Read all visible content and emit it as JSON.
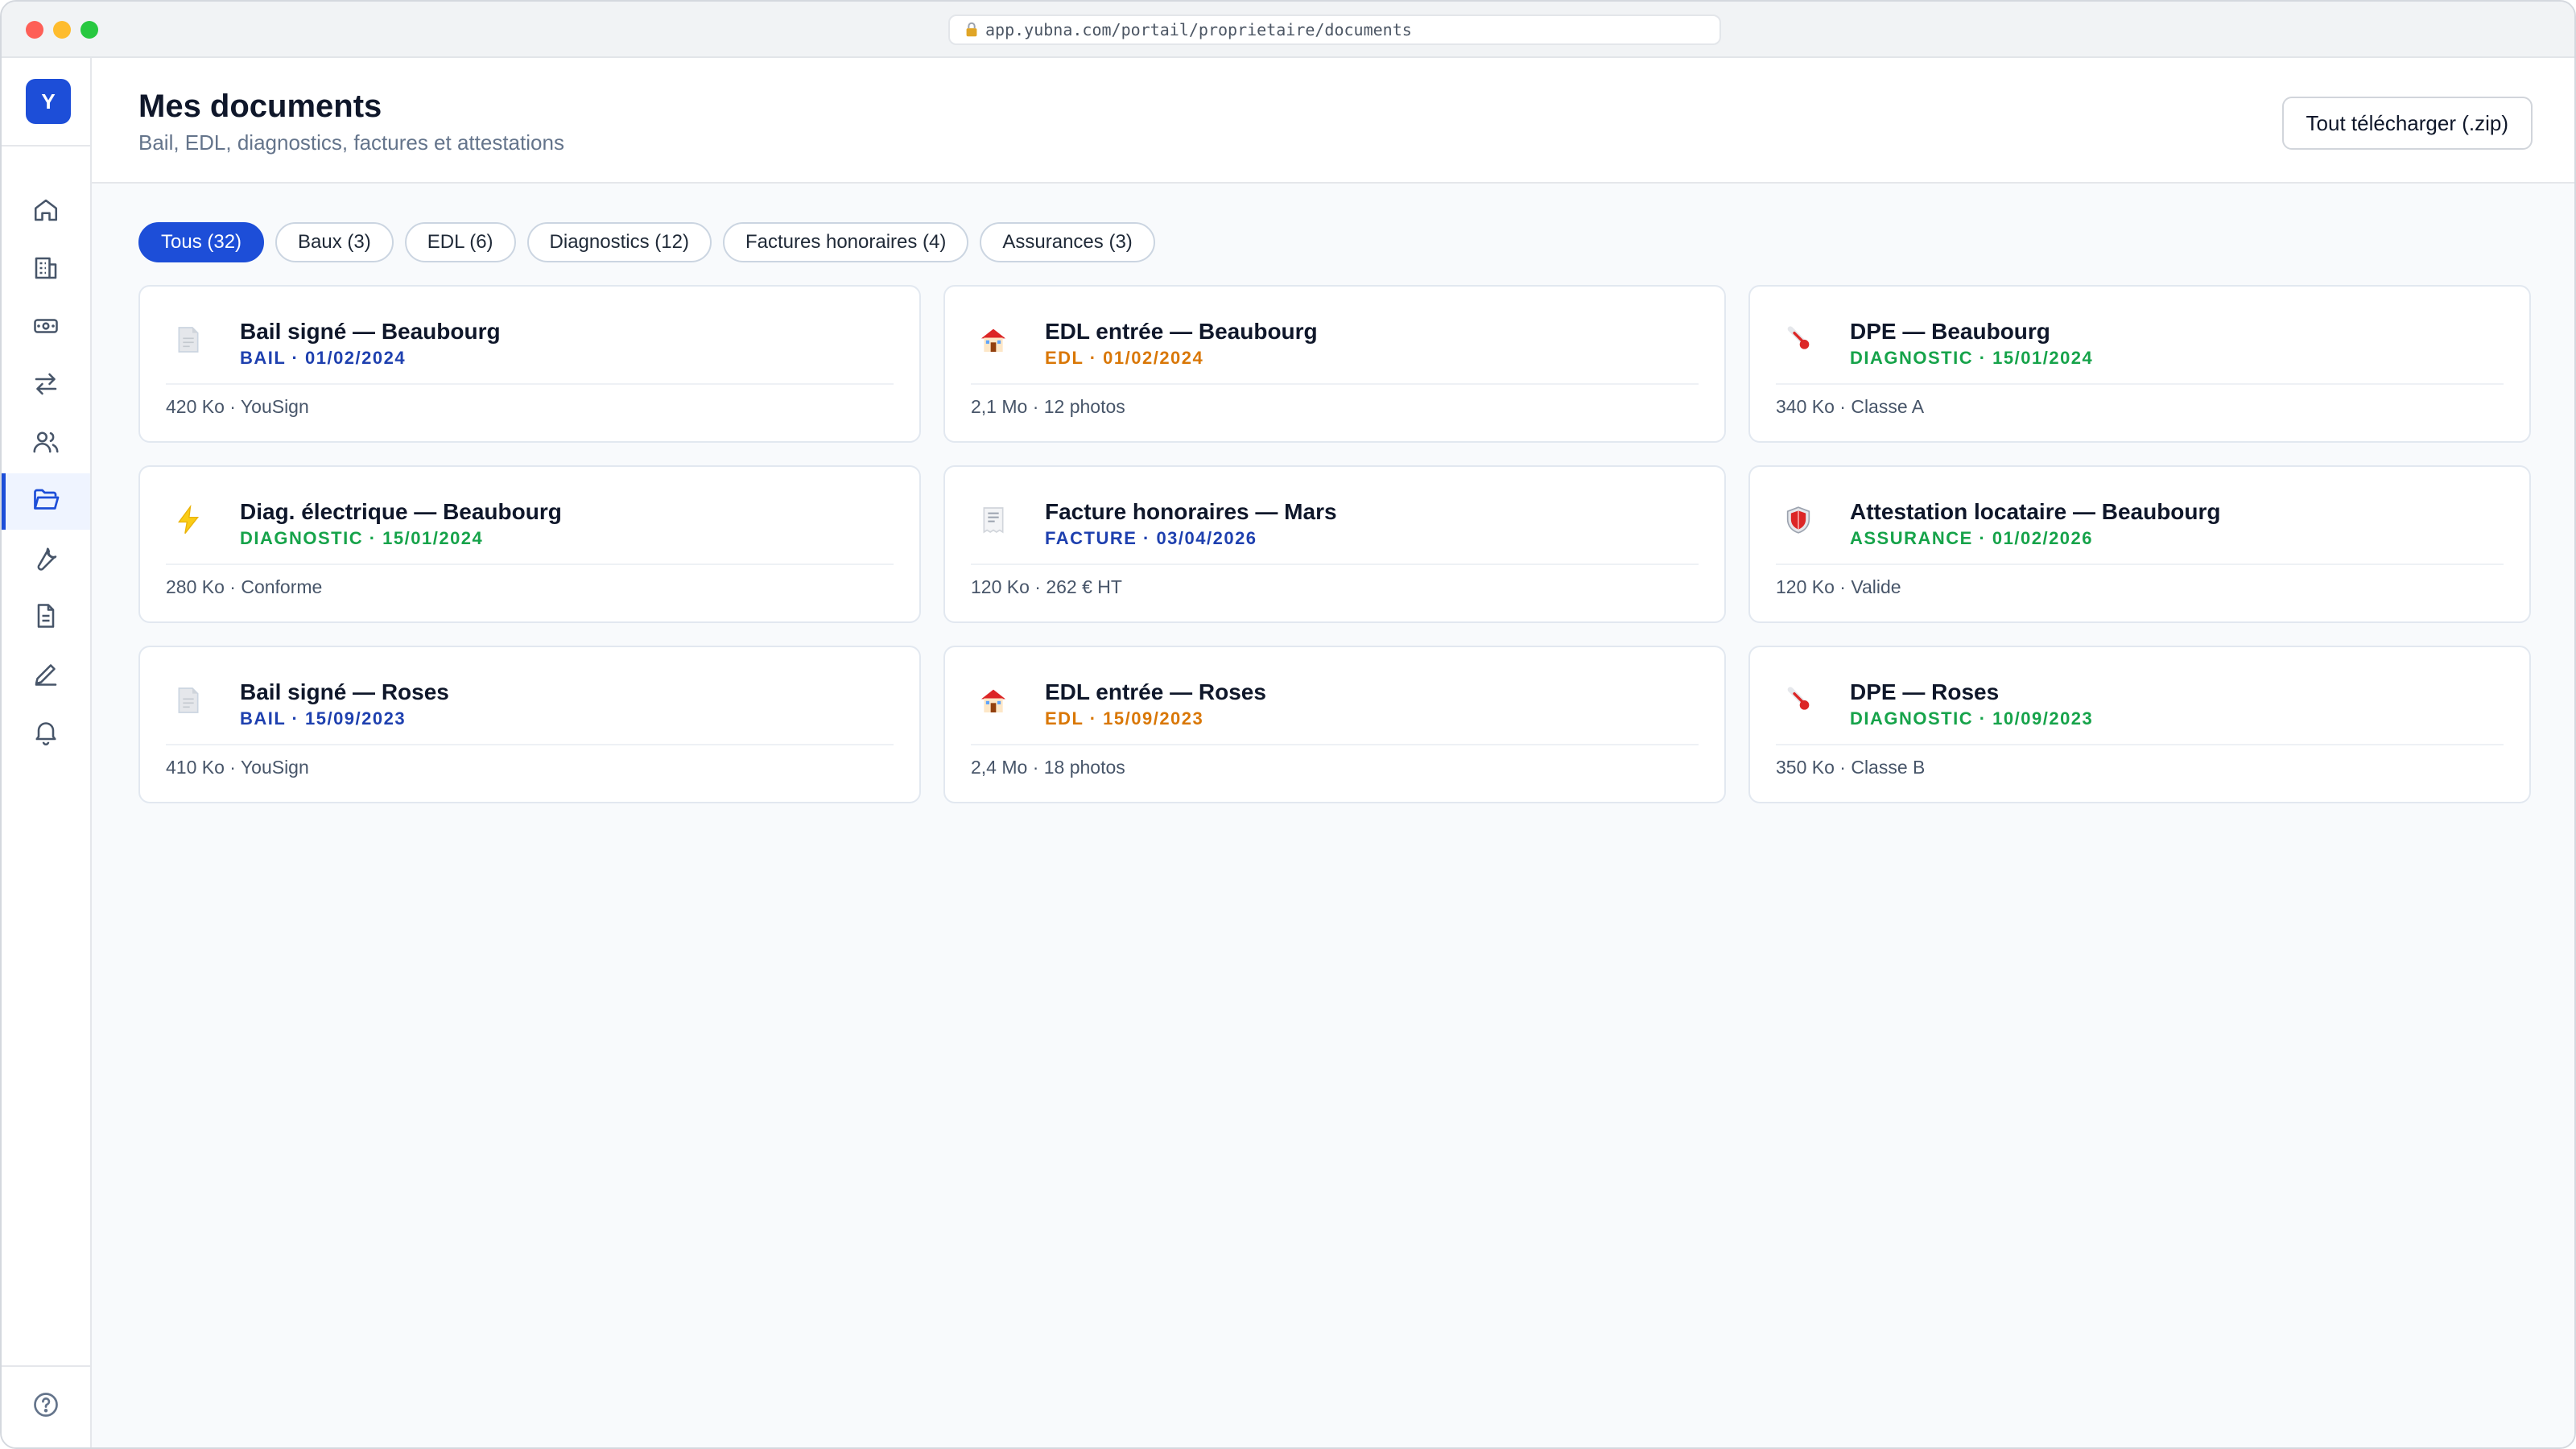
{
  "browser": {
    "url": "app.yubna.com/portail/proprietaire/documents"
  },
  "sidebar": {
    "logo": "Y",
    "items": [
      {
        "icon": "home-icon"
      },
      {
        "icon": "building-icon"
      },
      {
        "icon": "money-icon"
      },
      {
        "icon": "transfer-icon"
      },
      {
        "icon": "users-icon"
      },
      {
        "icon": "folder-icon",
        "active": true
      },
      {
        "icon": "wrench-icon"
      },
      {
        "icon": "file-icon"
      },
      {
        "icon": "pen-icon"
      },
      {
        "icon": "bell-icon"
      }
    ],
    "help_icon": "help-icon"
  },
  "header": {
    "title": "Mes documents",
    "subtitle": "Bail, EDL, diagnostics, factures et attestations",
    "download_label": "Tout télécharger (.zip)"
  },
  "filters": [
    {
      "label": "Tous (32)",
      "active": true
    },
    {
      "label": "Baux (3)"
    },
    {
      "label": "EDL (6)"
    },
    {
      "label": "Diagnostics (12)"
    },
    {
      "label": "Factures honoraires (4)"
    },
    {
      "label": "Assurances (3)"
    }
  ],
  "colors": {
    "accent": "#1d4ed8",
    "bail": "#1e40af",
    "edl": "#d97706",
    "diagnostic": "#16a34a",
    "facture": "#1e40af",
    "assurance": "#16a34a"
  },
  "documents": [
    {
      "icon": "page-icon",
      "title": "Bail signé — Beaubourg",
      "meta": "BAIL · 01/02/2024",
      "kind": "bail",
      "info": "420 Ko · YouSign"
    },
    {
      "icon": "house-icon",
      "title": "EDL entrée — Beaubourg",
      "meta": "EDL · 01/02/2024",
      "kind": "edl",
      "info": "2,1 Mo · 12 photos"
    },
    {
      "icon": "thermometer-icon",
      "title": "DPE — Beaubourg",
      "meta": "DIAGNOSTIC · 15/01/2024",
      "kind": "diagnostic",
      "info": "340 Ko · Classe A"
    },
    {
      "icon": "lightning-icon",
      "title": "Diag. électrique — Beaubourg",
      "meta": "DIAGNOSTIC · 15/01/2024",
      "kind": "diagnostic",
      "info": "280 Ko · Conforme"
    },
    {
      "icon": "receipt-icon",
      "title": "Facture honoraires — Mars",
      "meta": "FACTURE · 03/04/2026",
      "kind": "facture",
      "info": "120 Ko · 262 € HT"
    },
    {
      "icon": "shield-icon",
      "title": "Attestation locataire — Beaubourg",
      "meta": "ASSURANCE · 01/02/2026",
      "kind": "assurance",
      "info": "120 Ko · Valide"
    },
    {
      "icon": "page-icon",
      "title": "Bail signé — Roses",
      "meta": "BAIL · 15/09/2023",
      "kind": "bail",
      "info": "410 Ko · YouSign"
    },
    {
      "icon": "house-icon",
      "title": "EDL entrée — Roses",
      "meta": "EDL · 15/09/2023",
      "kind": "edl",
      "info": "2,4 Mo · 18 photos"
    },
    {
      "icon": "thermometer-icon",
      "title": "DPE — Roses",
      "meta": "DIAGNOSTIC · 10/09/2023",
      "kind": "diagnostic",
      "info": "350 Ko · Classe B"
    }
  ]
}
